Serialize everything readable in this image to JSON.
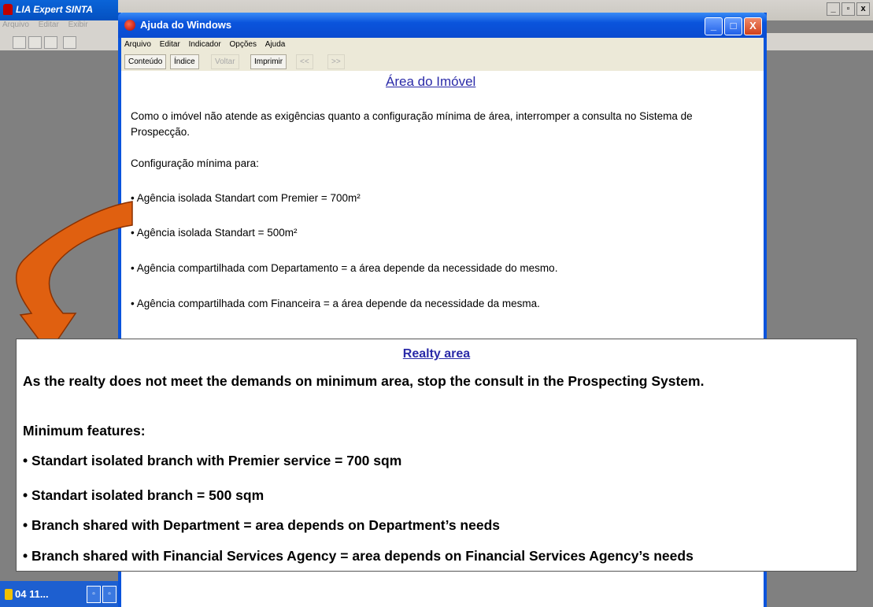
{
  "bg_app": {
    "title": "LIA Expert SINTA",
    "menu": [
      "Arquivo",
      "Editar",
      "Exibir"
    ],
    "window_controls": [
      "_",
      "▫",
      "x"
    ],
    "taskbar": {
      "label": "04  11...",
      "buttons": [
        "▫",
        "▫"
      ]
    }
  },
  "help_window": {
    "title": "Ajuda do Windows",
    "controls": {
      "minimize": "_",
      "maximize": "□",
      "close": "X"
    },
    "menu": [
      "Arquivo",
      "Editar",
      "Indicador",
      "Opções",
      "Ajuda"
    ],
    "toolbar": [
      {
        "label": "Conteúdo",
        "enabled": true
      },
      {
        "label": "Índice",
        "enabled": true
      },
      {
        "label": "Voltar",
        "enabled": false
      },
      {
        "label": "Imprimir",
        "enabled": true
      },
      {
        "label": "<<",
        "enabled": false
      },
      {
        "label": ">>",
        "enabled": false
      }
    ],
    "heading": "Área do Imóvel",
    "paragraphs": [
      "Como o imóvel não atende as exigências quanto a configuração mínima de área, interromper a consulta no Sistema de Prospecção.",
      "Configuração mínima para:",
      "• Agência isolada Standart com Premier = 700m²",
      "• Agência isolada Standart = 500m²",
      "• Agência compartilhada com Departamento = a área depende da necessidade do mesmo.",
      "• Agência compartilhada com Financeira = a área depende da necessidade da mesma."
    ]
  },
  "translation": {
    "heading": "Realty area",
    "paragraphs": [
      "As the realty does not meet the demands on minimum area, stop the consult in the Prospecting System.",
      "Minimum features:",
      "• Standart isolated branch with Premier service = 700 sqm",
      "• Standart isolated branch = 500 sqm",
      "• Branch shared with Department = area depends on Department’s needs",
      "• Branch shared with Financial Services Agency = area depends on Financial Services Agency’s needs"
    ]
  },
  "colors": {
    "xp_blue": "#0a54dc",
    "heading_blue": "#2a2aa8",
    "arrow_orange": "#e06010"
  },
  "icons": [
    "app-icon",
    "help-book-icon",
    "minimize-icon",
    "maximize-icon",
    "close-icon",
    "curved-arrow-icon"
  ]
}
